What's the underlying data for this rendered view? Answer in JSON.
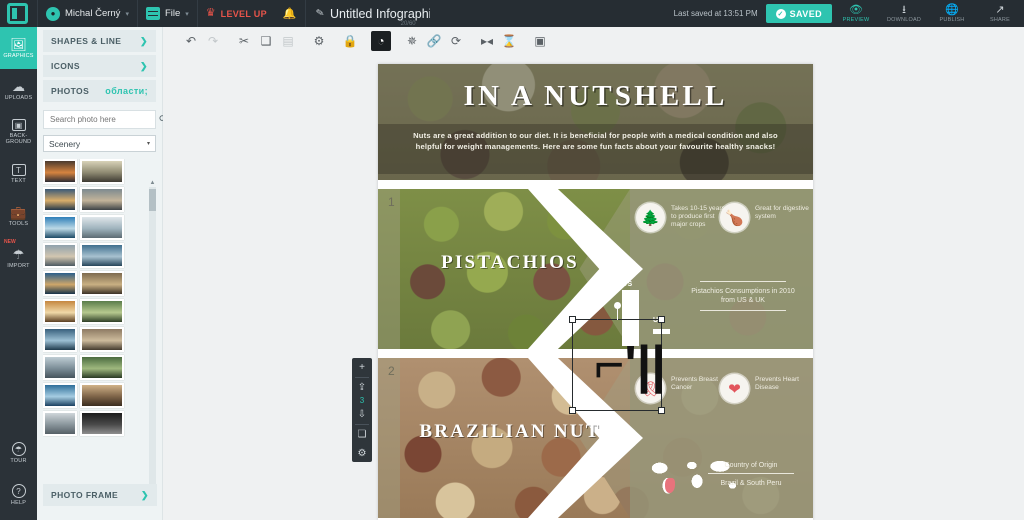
{
  "topbar": {
    "logo": "canva-logo-icon",
    "user": {
      "name": "Michal Černý",
      "avatar_icon": "user-avatar-icon",
      "caret": "▾"
    },
    "file_menu": {
      "label": "File",
      "caret": "▾",
      "icon": "file-menu-icon"
    },
    "level_up": {
      "label": "LEVEL UP",
      "icon": "crown-icon"
    },
    "notifications_icon": "bell-icon",
    "document": {
      "title": "Untitled Infographi",
      "char_count": "20/60",
      "edit_icon": "pencil-icon"
    },
    "saved_status": "Last saved at 13:51 PM",
    "saved_button": {
      "label": "SAVED",
      "check": "✓"
    },
    "actions": [
      {
        "label": "PREVIEW",
        "icon": "eye-icon"
      },
      {
        "label": "DOWNLOAD",
        "icon": "download-icon"
      },
      {
        "label": "PUBLISH",
        "icon": "globe-icon"
      },
      {
        "label": "SHARE",
        "icon": "share-icon"
      }
    ]
  },
  "rail": {
    "items": [
      {
        "label": "GRAPHICS",
        "icon": "image-icon",
        "active": true,
        "badge": ""
      },
      {
        "label": "UPLOADS",
        "icon": "cloud-upload-icon",
        "active": false,
        "badge": ""
      },
      {
        "label": "BACK-GROUND",
        "icon": "background-icon",
        "active": false,
        "badge": ""
      },
      {
        "label": "TEXT",
        "icon": "text-T-icon",
        "active": false,
        "badge": ""
      },
      {
        "label": "TOOLS",
        "icon": "toolbox-icon",
        "active": false,
        "badge": ""
      },
      {
        "label": "IMPORT",
        "icon": "import-cloud-icon",
        "active": false,
        "badge": "NEW"
      }
    ],
    "bottom": [
      {
        "label": "TOUR",
        "icon": "umbrella-icon"
      },
      {
        "label": "HELP",
        "icon": "question-icon"
      }
    ]
  },
  "panel": {
    "accordions": [
      {
        "label": "SHAPES & LINE",
        "arrow": "❯",
        "open": false
      },
      {
        "label": "ICONS",
        "arrow": "❯",
        "open": false
      },
      {
        "label": "PHOTOS",
        "arrow": "❯",
        "open": true
      }
    ],
    "search": {
      "placeholder": "Search photo here",
      "value": "",
      "icon": "search-icon"
    },
    "category": {
      "value": "Scenery",
      "caret": "▾"
    },
    "thumb_count": 20,
    "footer": {
      "label": "PHOTO FRAME",
      "arrow": "❯"
    }
  },
  "editor_toolbar": {
    "tools": [
      {
        "name": "undo",
        "glyph": "↶",
        "state": "enabled"
      },
      {
        "name": "redo",
        "glyph": "↷",
        "state": "disabled"
      },
      {
        "name": "cut",
        "glyph": "✂",
        "state": "enabled"
      },
      {
        "name": "copy",
        "glyph": "❐",
        "state": "enabled"
      },
      {
        "name": "paste",
        "glyph": "▤",
        "state": "disabled"
      },
      {
        "name": "delete",
        "glyph": "🗑",
        "state": "enabled"
      },
      {
        "name": "lock",
        "glyph": "🔒",
        "state": "enabled"
      },
      {
        "name": "fill-color",
        "glyph": "◗",
        "state": "active"
      },
      {
        "name": "effects",
        "glyph": "✸",
        "state": "enabled"
      },
      {
        "name": "link",
        "glyph": "🔗",
        "state": "enabled"
      },
      {
        "name": "rotate",
        "glyph": "⟳",
        "state": "enabled"
      },
      {
        "name": "flip-horizontal",
        "glyph": "◄►",
        "state": "enabled"
      },
      {
        "name": "flip-vertical",
        "glyph": "⧗",
        "state": "enabled"
      },
      {
        "name": "position",
        "glyph": "▣",
        "state": "enabled"
      }
    ]
  },
  "page_tools": {
    "add": "+",
    "move_up": "⇪",
    "page_number": "3",
    "move_down": "⇩",
    "duplicate": "❏",
    "delete": "✕",
    "settings": "⚙"
  },
  "design": {
    "hero": {
      "title": "IN A NUTSHELL",
      "subtitle": "Nuts are a great addition to our diet. It is beneficial for people with a medical condition and also helpful for weight managements. Here are some fun facts about your favourite healthy snacks!"
    },
    "sections": [
      {
        "number": "1",
        "name": "PISTACHIOS",
        "facts": [
          {
            "icon": "tree-icon",
            "text": "Takes 10-15 years to produce first major crops"
          },
          {
            "icon": "stomach-icon",
            "text": "Great for digestive system"
          }
        ],
        "stat": {
          "caption": "Pistachios Consumptions in 2010 from US & UK",
          "bars": [
            {
              "label": "US",
              "value": 100
            },
            {
              "label": "UK",
              "value": 38
            }
          ]
        }
      },
      {
        "number": "2",
        "name": "BRAZILIAN NUT",
        "facts": [
          {
            "icon": "ribbon-icon",
            "text": "Prevents Breast Cancer"
          },
          {
            "icon": "heart-icon",
            "text": "Prevents Heart Disease"
          }
        ],
        "stat": {
          "caption": "Country of Origin",
          "value": "Brazil & South Peru",
          "map_icon": "world-map-icon"
        }
      }
    ]
  },
  "selection": {
    "visible": true,
    "dragged_glyph": "⌐'||",
    "handles": 4,
    "rotate_handle": true
  },
  "colors": {
    "accent": "#2ec4b0",
    "topbar_bg": "#262d33",
    "rail_bg": "#2b3238",
    "panel_bg": "#eef3f4",
    "canvas_bg": "#eff1f2",
    "alert": "#e8544a",
    "section_tint": "#a2a184"
  }
}
